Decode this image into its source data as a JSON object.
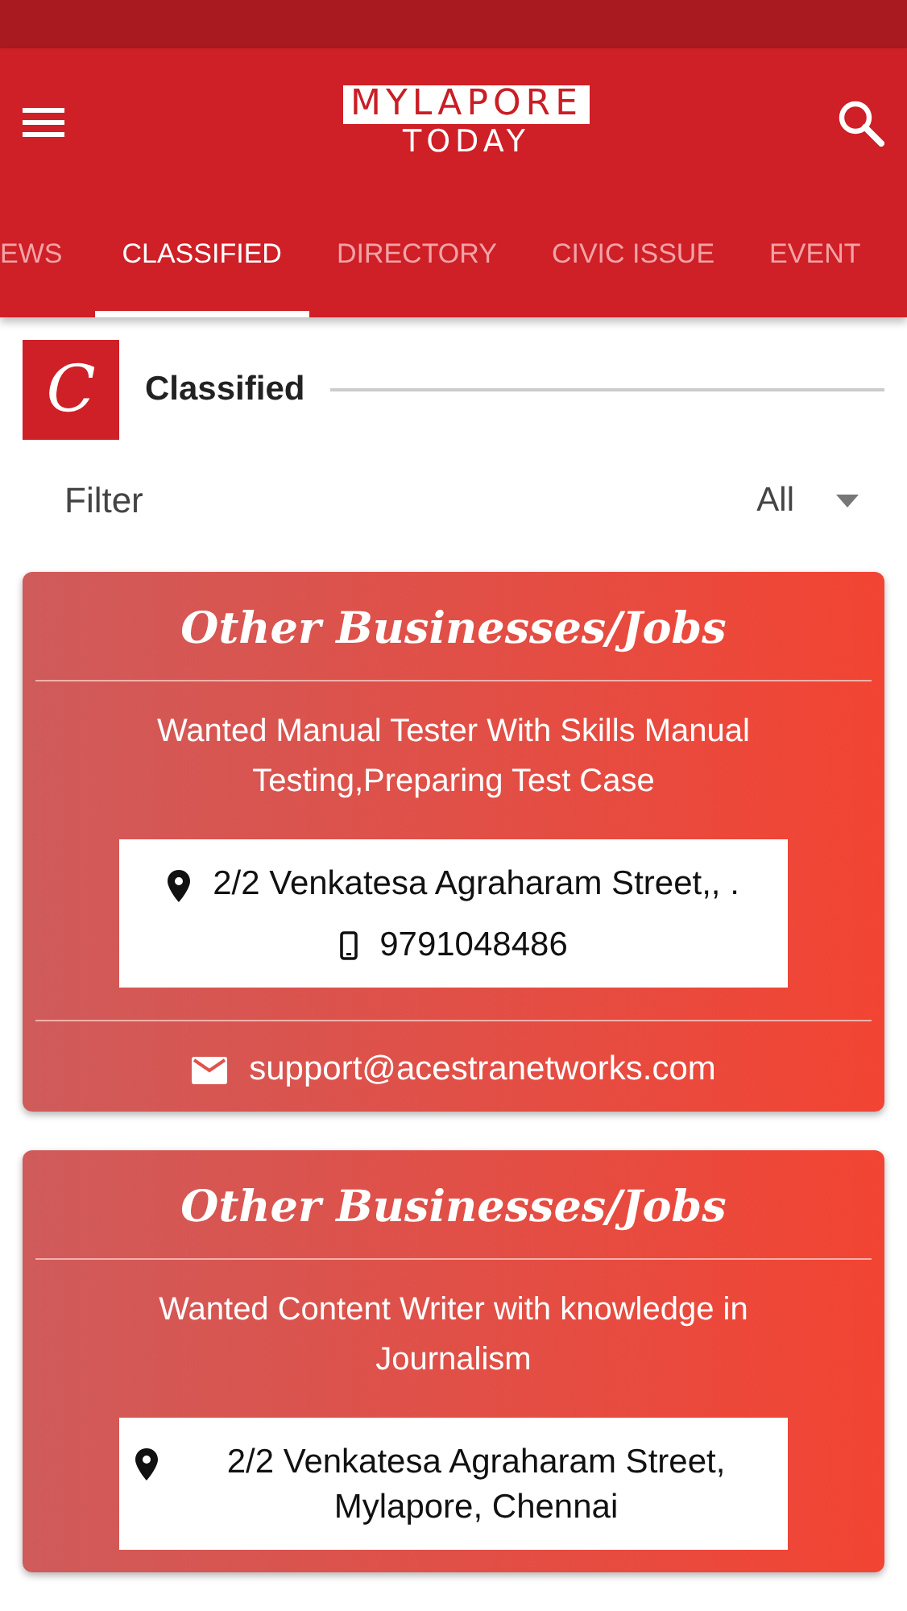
{
  "app_bar": {
    "logo_top": "MYLAPORE",
    "logo_bottom": "TODAY"
  },
  "tabs": [
    {
      "label": "EWS",
      "selected": false
    },
    {
      "label": "CLASSIFIED",
      "selected": true
    },
    {
      "label": "DIRECTORY",
      "selected": false
    },
    {
      "label": "CIVIC ISSUE",
      "selected": false
    },
    {
      "label": "EVENT",
      "selected": false
    }
  ],
  "section": {
    "badge": "C",
    "title": "Classified"
  },
  "filter": {
    "label": "Filter",
    "value": "All"
  },
  "listings": [
    {
      "category": "Other Businesses/Jobs",
      "description": "Wanted Manual Tester With Skills Manual Testing,Preparing Test Case",
      "address": "2/2 Venkatesa Agraharam Street,, .",
      "phone": "9791048486",
      "email": "support@acestranetworks.com"
    },
    {
      "category": "Other Businesses/Jobs",
      "description": "Wanted Content Writer with knowledge in Journalism",
      "address": "2/2 Venkatesa Agraharam Street, Mylapore, Chennai"
    }
  ]
}
